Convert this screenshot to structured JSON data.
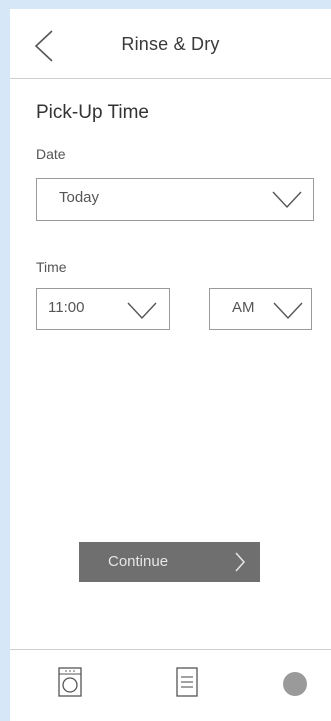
{
  "header": {
    "title": "Rinse & Dry",
    "back_icon": "chevron-left-icon"
  },
  "pickup": {
    "section_title": "Pick-Up Time",
    "date_label": "Date",
    "date_value": "Today",
    "time_label": "Time",
    "time_value": "11:00",
    "period_value": "AM",
    "dropdown_icon": "chevron-down-icon"
  },
  "actions": {
    "continue_label": "Continue",
    "continue_icon": "chevron-right-icon"
  },
  "tabbar": {
    "tabs": [
      {
        "icon": "washing-machine-icon"
      },
      {
        "icon": "list-document-icon"
      },
      {
        "icon": "profile-circle-icon"
      }
    ]
  },
  "colors": {
    "page_background": "#d6e7f7",
    "button": "#6f6f6f",
    "text": "#333333",
    "border": "#9a9a9a"
  }
}
